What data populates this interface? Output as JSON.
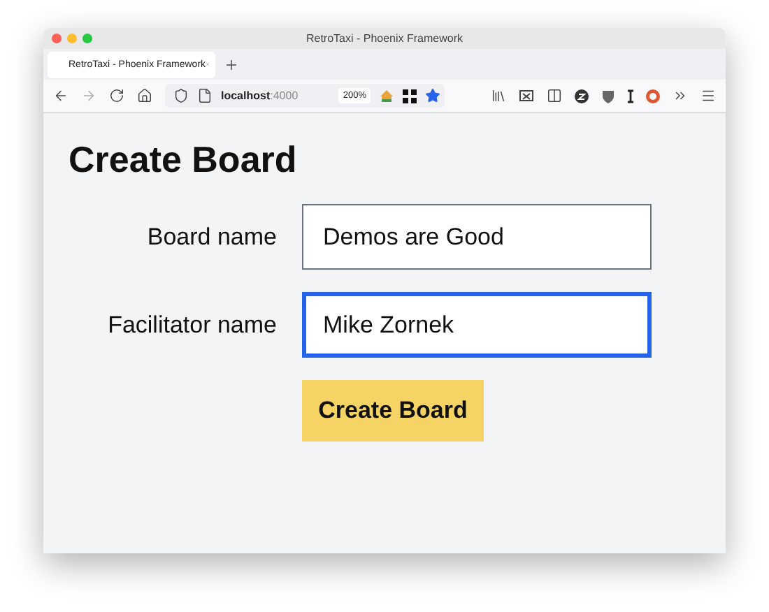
{
  "window": {
    "title": "RetroTaxi - Phoenix Framework"
  },
  "tabs": [
    {
      "label": "RetroTaxi - Phoenix Framework",
      "selected": true
    }
  ],
  "toolbar": {
    "url": "**localhost**:4000",
    "zoom": "200%",
    "bookmarked": true
  },
  "page": {
    "heading": "Create Board",
    "fields": [
      {
        "label": "Board name",
        "value": "Demos are Good",
        "focused": false
      },
      {
        "label": "Facilitator name",
        "value": "Mike Zornek",
        "focused": true
      }
    ],
    "submit": "Create Board"
  }
}
